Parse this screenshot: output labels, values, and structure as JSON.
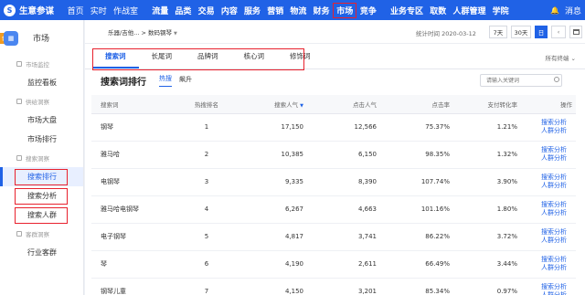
{
  "topnav": {
    "brand": "生意参谋",
    "items": [
      "首页",
      "实时",
      "作战室",
      "流量",
      "品类",
      "交易",
      "内容",
      "服务",
      "营销",
      "物流",
      "财务",
      "市场",
      "竞争",
      "业务专区",
      "取数",
      "人群管理",
      "学院"
    ],
    "active_index": 11,
    "right_text": "消息",
    "accent": "#2062e6"
  },
  "sidebar": {
    "title": "市场",
    "tab_badge": "售",
    "groups": [
      {
        "label": "市场监控",
        "items": [
          "监控看板"
        ]
      },
      {
        "label": "供给洞察",
        "items": [
          "市场大盘",
          "市场排行"
        ]
      },
      {
        "label": "搜索洞察",
        "items": [
          "搜索排行",
          "搜索分析",
          "搜索人群"
        ]
      },
      {
        "label": "客群洞察",
        "items": [
          "行业客群"
        ]
      }
    ],
    "selected_item": "搜索排行"
  },
  "filter": {
    "breadcrumb": "乐器/吉他... > 数码钢琴",
    "stat_time": "统计时间 2020-03-12",
    "ranges": [
      "7天",
      "30天",
      "日"
    ],
    "active_range": "日"
  },
  "tabs": [
    "搜索词",
    "长尾词",
    "品牌词",
    "核心词",
    "修饰词"
  ],
  "active_tab": "搜索词",
  "device_select": "所有终端",
  "rank": {
    "title": "搜索词排行",
    "subtabs": [
      "热搜",
      "飙升"
    ],
    "active_subtab": "热搜",
    "search_placeholder": "请输入关键词"
  },
  "table": {
    "headers": [
      "搜索词",
      "热搜排名",
      "搜索人气",
      "点击人气",
      "点击率",
      "支付转化率",
      "操作"
    ],
    "sort_indicator": "▼",
    "action_analysis": "搜索分析",
    "action_crowd": "人群分析",
    "rows": [
      {
        "word": "钢琴",
        "rank": "1",
        "search": "17,150",
        "click": "12,566",
        "ctr": "75.37%",
        "cvr": "1.21%"
      },
      {
        "word": "雅马哈",
        "rank": "2",
        "search": "10,385",
        "click": "6,150",
        "ctr": "98.35%",
        "cvr": "1.32%"
      },
      {
        "word": "电钢琴",
        "rank": "3",
        "search": "9,335",
        "click": "8,390",
        "ctr": "107.74%",
        "cvr": "3.90%"
      },
      {
        "word": "雅马哈电钢琴",
        "rank": "4",
        "search": "6,267",
        "click": "4,663",
        "ctr": "101.16%",
        "cvr": "1.80%"
      },
      {
        "word": "电子钢琴",
        "rank": "5",
        "search": "4,817",
        "click": "3,741",
        "ctr": "86.22%",
        "cvr": "3.72%"
      },
      {
        "word": "琴",
        "rank": "6",
        "search": "4,190",
        "click": "2,611",
        "ctr": "66.49%",
        "cvr": "3.44%"
      },
      {
        "word": "钢琴儿童",
        "rank": "7",
        "search": "4,150",
        "click": "3,201",
        "ctr": "85.34%",
        "cvr": "0.97%"
      }
    ]
  }
}
